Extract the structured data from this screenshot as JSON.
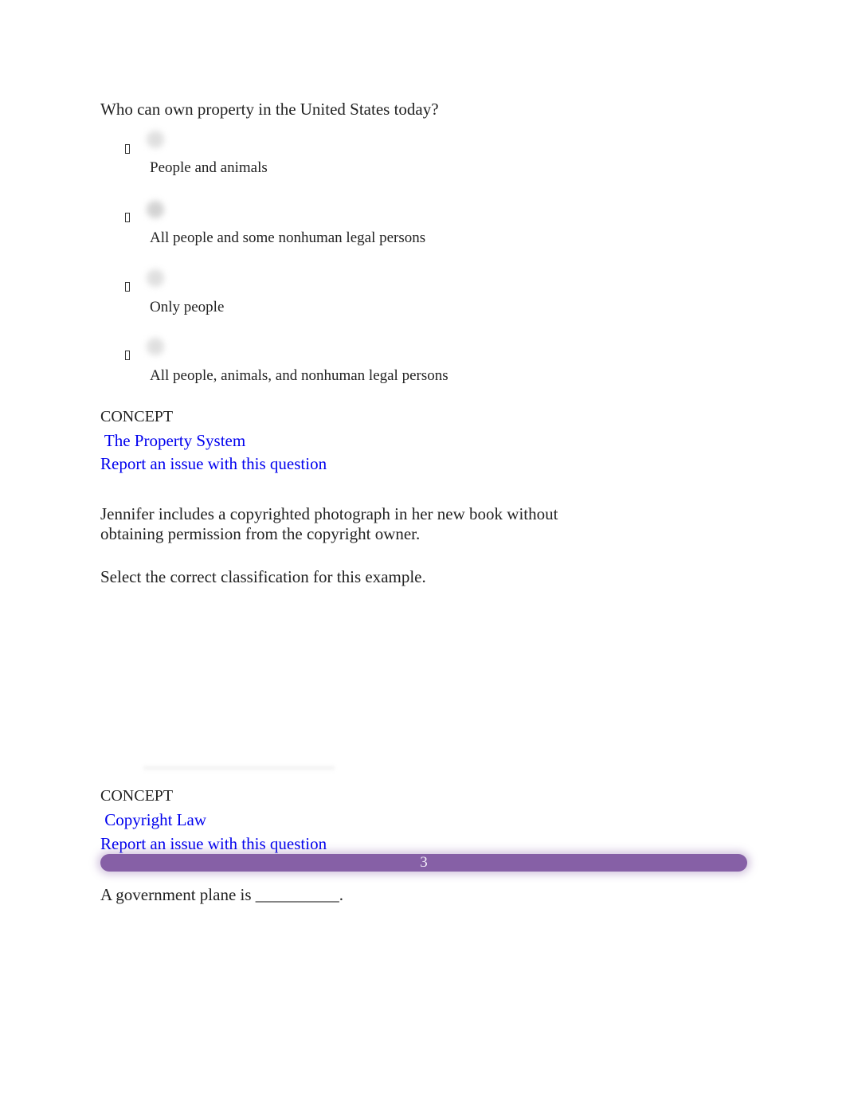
{
  "question1": {
    "prompt": "Who can own property in the United States today?",
    "options": [
      {
        "label": "People and animals"
      },
      {
        "label": "All people and some nonhuman legal persons"
      },
      {
        "label": "Only people"
      },
      {
        "label": "All people, animals, and nonhuman legal persons"
      }
    ],
    "concept_label": "CONCEPT",
    "concept_link": " The Property System",
    "report_link": "Report an issue with this question"
  },
  "question2": {
    "prompt_line1": "Jennifer includes a copyrighted photograph in her new book without",
    "prompt_line2": "obtaining permission from the copyright owner.",
    "instruction": "Select the correct classification for this example.",
    "concept_label": "CONCEPT",
    "concept_link": " Copyright Law",
    "report_link": "Report an issue with this question"
  },
  "page_bar": {
    "page_number": "3",
    "color": "#8660a6"
  },
  "question3": {
    "prompt": "A government plane is __________."
  }
}
